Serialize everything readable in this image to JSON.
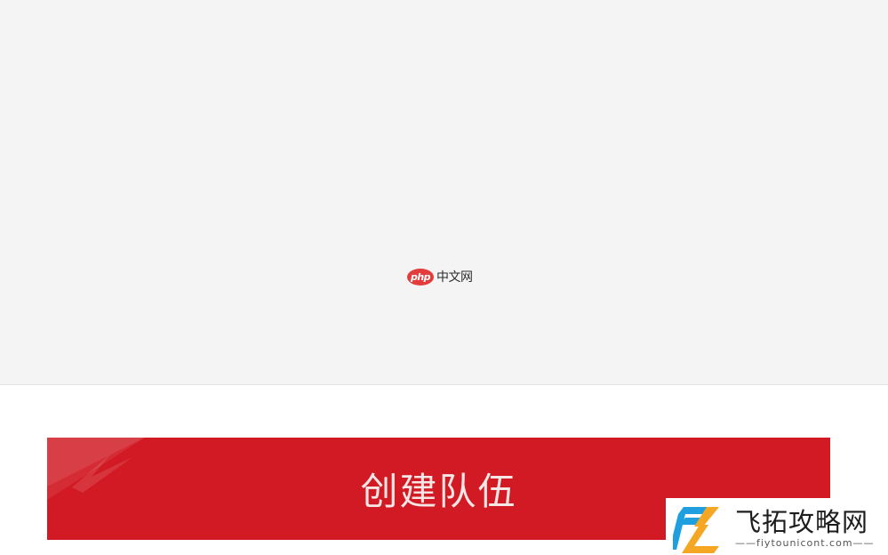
{
  "watermark": {
    "logo_text": "php",
    "site_text": "中文网"
  },
  "create_team_button": {
    "label": "创建队伍",
    "color": "#d11a23"
  },
  "site_badge": {
    "name": "飞拓攻略网",
    "url": "——fiytounicont.com——"
  },
  "colors": {
    "background_top": "#f4f4f4",
    "background_bottom": "#ffffff",
    "accent_red": "#d11a23",
    "logo_blue": "#1f9fe0",
    "logo_orange": "#f5a623"
  }
}
